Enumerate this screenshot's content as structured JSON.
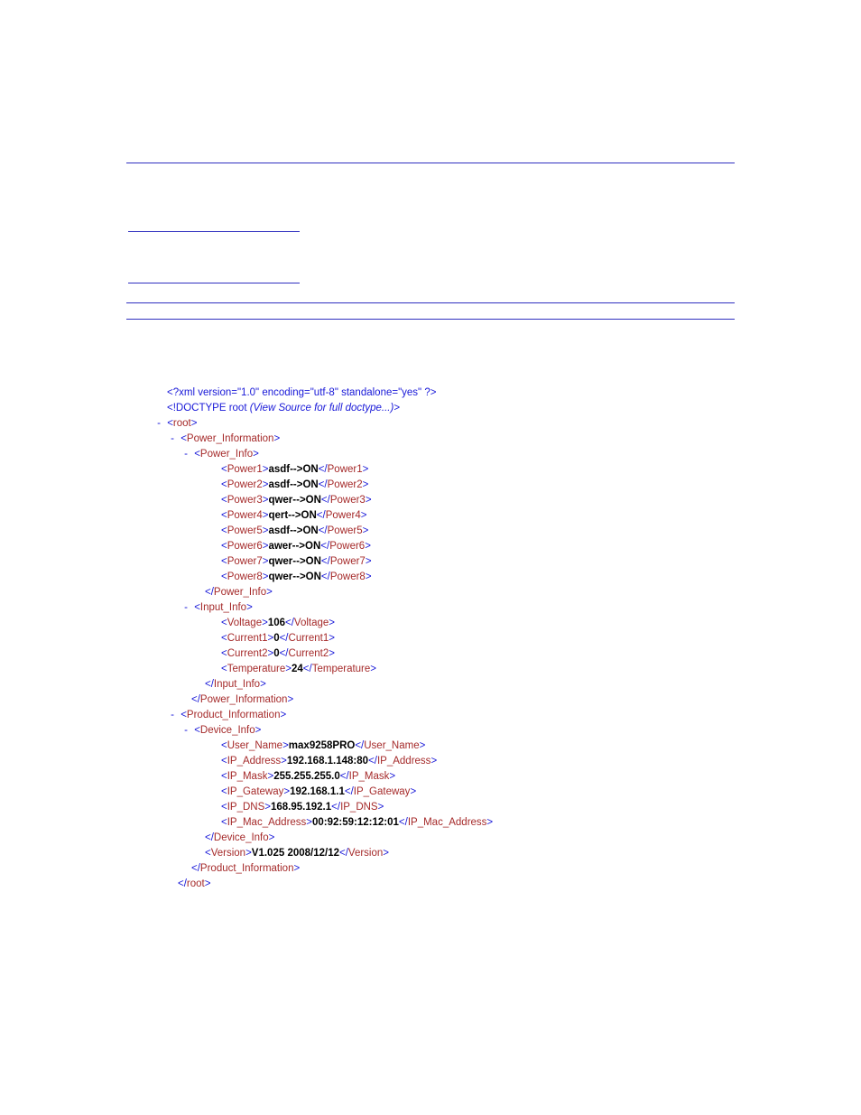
{
  "xmlDecl": "<?xml version=\"1.0\" encoding=\"utf-8\" standalone=\"yes\" ?>",
  "doctypePre": "<!DOCTYPE root ",
  "doctypeItalic": "(View Source for full doctype...)",
  "doctypePost": ">",
  "root": "root",
  "powerInformation": "Power_Information",
  "powerInfo": "Power_Info",
  "inputInfo": "Input_Info",
  "productInformation": "Product_Information",
  "deviceInfo": "Device_Info",
  "powers": [
    {
      "tag": "Power1",
      "val": "asdf-->ON"
    },
    {
      "tag": "Power2",
      "val": "asdf-->ON"
    },
    {
      "tag": "Power3",
      "val": "qwer-->ON"
    },
    {
      "tag": "Power4",
      "val": "qert-->ON"
    },
    {
      "tag": "Power5",
      "val": "asdf-->ON"
    },
    {
      "tag": "Power6",
      "val": "awer-->ON"
    },
    {
      "tag": "Power7",
      "val": "qwer-->ON"
    },
    {
      "tag": "Power8",
      "val": "qwer-->ON"
    }
  ],
  "voltage": {
    "tag": "Voltage",
    "val": "106"
  },
  "current1": {
    "tag": "Current1",
    "val": "0"
  },
  "current2": {
    "tag": "Current2",
    "val": "0"
  },
  "temperature": {
    "tag": "Temperature",
    "val": "24"
  },
  "userName": {
    "tag": "User_Name",
    "val": "max9258PRO"
  },
  "ipAddress": {
    "tag": "IP_Address",
    "val": "192.168.1.148:80"
  },
  "ipMask": {
    "tag": "IP_Mask",
    "val": "255.255.255.0"
  },
  "ipGateway": {
    "tag": "IP_Gateway",
    "val": "192.168.1.1"
  },
  "ipDns": {
    "tag": "IP_DNS",
    "val": "168.95.192.1"
  },
  "ipMac": {
    "tag": "IP_Mac_Address",
    "val": "00:92:59:12:12:01"
  },
  "version": {
    "tag": "Version",
    "val": "V1.025 2008/12/12"
  }
}
